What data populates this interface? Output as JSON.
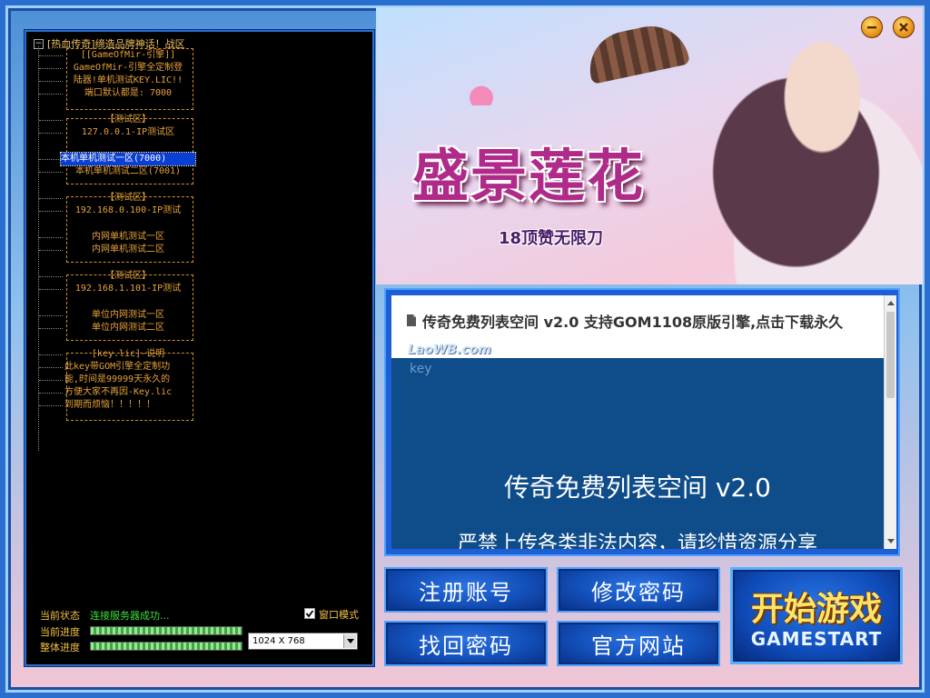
{
  "window": {
    "minimize_icon": "minus-icon",
    "close_icon": "x-icon"
  },
  "hero": {
    "logo_title": "盛景莲花",
    "logo_subtitle": "18顶赞无限刀"
  },
  "tree": {
    "root": "[热血传奇]缔造品牌神话！战区",
    "items": [
      "[[GameOfMir-引擎]]",
      "GameOfMir-引擎全定制登",
      "陆器!单机测试KEY.LIC!!",
      "端口默认都是: 7000",
      "【测试区】",
      "127.0.0.1-IP测试区",
      "本机单机测试一区(7000)",
      "本机单机测试二区(7001)",
      "【测试区】",
      "192.168.0.100-IP测试",
      "内网单机测试一区",
      "内网单机测试二区",
      "【测试区】",
      "192.168.1.101-IP测试",
      "单位内网测试一区",
      "单位内网测试二区",
      "[key.lic]-说明",
      "此key带GOM引擎全定制功",
      "能,时间是99999天永久的",
      "方便大家不再因-Key.lic",
      "到期而烦恼！！！！！"
    ]
  },
  "status": {
    "state_label": "当前状态",
    "state_value": "连接服务器成功...",
    "progress_label": "当前进度",
    "overall_label": "整体进度",
    "current_progress": 1.0,
    "overall_progress": 1.0,
    "window_mode_label": "窗口模式",
    "window_mode_checked": true,
    "resolution": "1024 X 768"
  },
  "news": {
    "header": "传奇免费列表空间 v2.0 支持GOM1108原版引擎,点击下载永久",
    "watermark": "LaoWB.com",
    "key_text": "key",
    "title": "传奇免费列表空间 v2.0",
    "text": "严禁上传各类非法内容，请珍惜资源分享"
  },
  "buttons": {
    "register": "注册账号",
    "change_password": "修改密码",
    "recover_password": "找回密码",
    "official_site": "官方网站",
    "start_main": "开始游戏",
    "start_sub": "GAMESTART"
  },
  "colors": {
    "accent": "#2a6fd0",
    "tree_text": "#e7a23a",
    "status_ok": "#3be03b",
    "start_text": "#ffe46a"
  }
}
